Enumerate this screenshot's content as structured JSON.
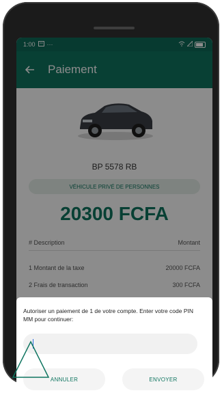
{
  "status_bar": {
    "time": "1:00",
    "left_icons": [
      "notification-icon",
      "more-dots-icon"
    ],
    "right_icons": [
      "wifi-icon",
      "signal-icon",
      "battery-icon"
    ]
  },
  "appbar": {
    "title": "Paiement",
    "back_icon": "arrow-left-icon"
  },
  "vehicle": {
    "image": "car-image",
    "plate": "BP 5578 RB",
    "category": "VÉHICULE PRIVÉ DE PERSONNES"
  },
  "amount": "20300 FCFA",
  "table": {
    "headers": [
      "# Description",
      "Montant"
    ],
    "rows": [
      {
        "description": "1  Montant de la taxe",
        "amount": "20000 FCFA"
      },
      {
        "description": "2  Frais de transaction",
        "amount": "300 FCFA"
      }
    ]
  },
  "dialog": {
    "message": "Autoriser un paiement de 1 de votre compte. Enter votre code PIN MM pour continuer:",
    "pin_value": "",
    "cancel_label": "ANNULER",
    "send_label": "ENVOYER"
  },
  "colors": {
    "primary": "#0f7560",
    "status": "#0d6a58",
    "chip_bg": "#e6efe9"
  }
}
